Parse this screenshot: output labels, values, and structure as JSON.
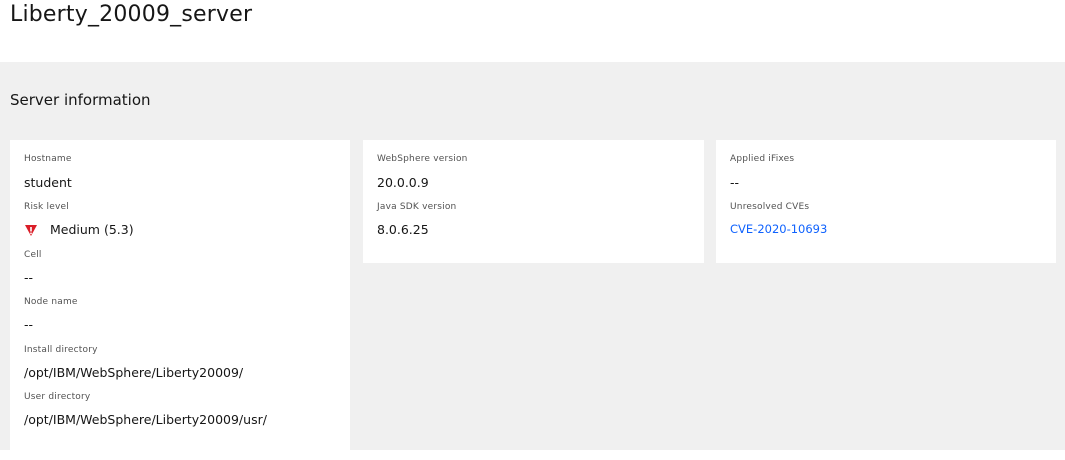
{
  "page": {
    "title": "Liberty_20009_server"
  },
  "section": {
    "title": "Server information"
  },
  "server": {
    "hostname_label": "Hostname",
    "hostname": "student",
    "risk_label": "Risk level",
    "risk_value": "Medium (5.3)",
    "risk_icon": "warning-triangle-icon",
    "risk_color": "#da1e28",
    "cell_label": "Cell",
    "cell": "--",
    "node_label": "Node name",
    "node": "--",
    "install_dir_label": "Install directory",
    "install_dir": "/opt/IBM/WebSphere/Liberty20009/",
    "user_dir_label": "User directory",
    "user_dir": "/opt/IBM/WebSphere/Liberty20009/usr/"
  },
  "versions": {
    "websphere_label": "WebSphere version",
    "websphere": "20.0.0.9",
    "java_label": "Java SDK version",
    "java": "8.0.6.25"
  },
  "fixes": {
    "ifixes_label": "Applied iFixes",
    "ifixes": "--",
    "cves_label": "Unresolved CVEs",
    "cve": "CVE-2020-10693",
    "link_color": "#0f62fe"
  }
}
